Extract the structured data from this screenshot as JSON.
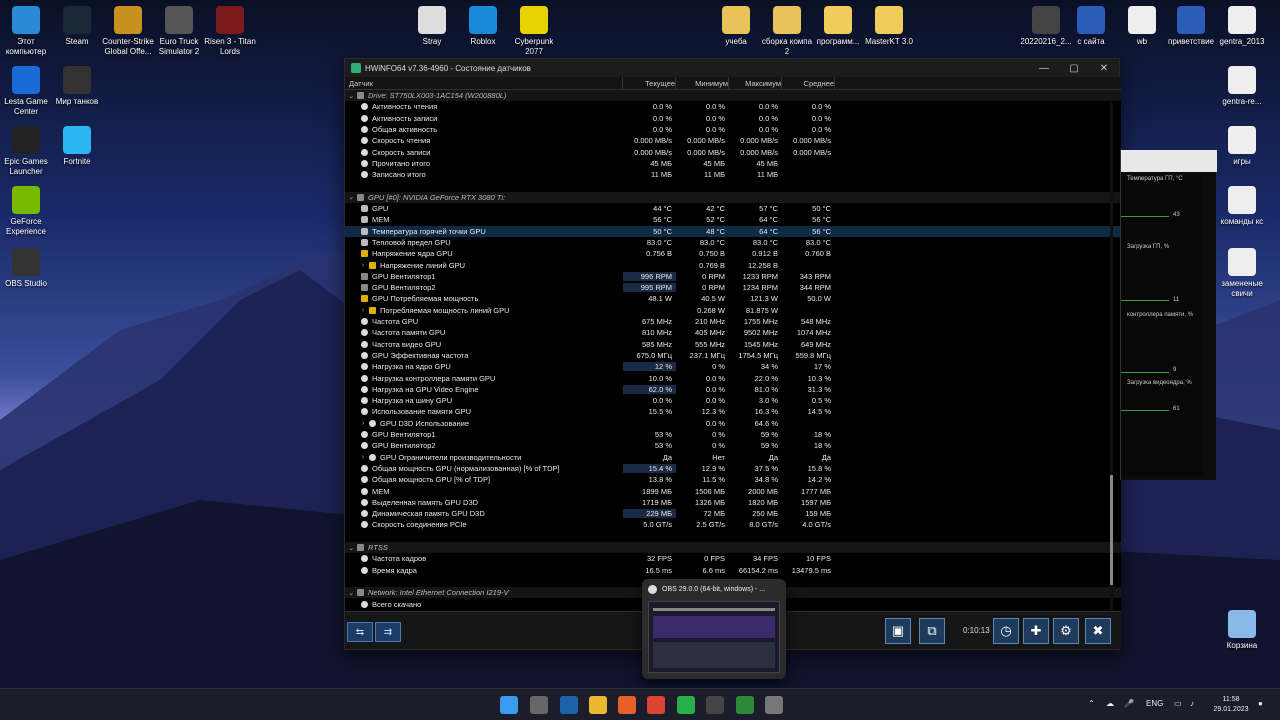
{
  "desktop_icons": [
    {
      "label": "Этот компьютер",
      "icon": "monitor-icon",
      "color": "#2a8ad8"
    },
    {
      "label": "Steam",
      "icon": "steam-icon",
      "color": "#1b2838"
    },
    {
      "label": "Counter-Strike Global Offe...",
      "icon": "csgo-icon",
      "color": "#c8901e"
    },
    {
      "label": "Euro Truck Simulator 2",
      "icon": "truck-icon",
      "color": "#555"
    },
    {
      "label": "Risen 3 - Titan Lords",
      "icon": "risen-icon",
      "color": "#7a1a1a"
    },
    {
      "label": "Stray",
      "icon": "cat-icon",
      "color": "#ddd"
    },
    {
      "label": "Roblox",
      "icon": "roblox-icon",
      "color": "#1a8ad8"
    },
    {
      "label": "Cyberpunk 2077",
      "icon": "cyberpunk-icon",
      "color": "#e6d200"
    },
    {
      "label": "учеба",
      "icon": "folder-icon",
      "color": "#e8c25a"
    },
    {
      "label": "сборка компа 2",
      "icon": "folder-icon",
      "color": "#e8c25a"
    },
    {
      "label": "программ...",
      "icon": "folder-icon",
      "color": "#f0cc5a"
    },
    {
      "label": "MasterKT 3.0",
      "icon": "folder-icon",
      "color": "#f0cc5a"
    },
    {
      "label": "20220216_2...",
      "icon": "image-icon",
      "color": "#444"
    },
    {
      "label": "с сайта",
      "icon": "word-icon",
      "color": "#2b5db8"
    },
    {
      "label": "wb",
      "icon": "file-icon",
      "color": "#eee"
    },
    {
      "label": "приветствие",
      "icon": "word-icon",
      "color": "#2b5db8"
    },
    {
      "label": "gentra_2013",
      "icon": "spreadsheet-icon",
      "color": "#eee"
    },
    {
      "label": "Lesta Game Center",
      "icon": "lesta-icon",
      "color": "#1a6ad8"
    },
    {
      "label": "Мир танков",
      "icon": "tank-icon",
      "color": "#333"
    },
    {
      "label": "Epic Games Launcher",
      "icon": "epic-icon",
      "color": "#222"
    },
    {
      "label": "Fortnite",
      "icon": "fortnite-icon",
      "color": "#2ab6f0"
    },
    {
      "label": "GeForce Experience",
      "icon": "nvidia-icon",
      "color": "#76b900"
    },
    {
      "label": "OBS Studio",
      "icon": "obs-icon",
      "color": "#333"
    },
    {
      "label": "gentra-re...",
      "icon": "pdf-icon",
      "color": "#eee"
    },
    {
      "label": "игры",
      "icon": "file-icon",
      "color": "#eee"
    },
    {
      "label": "команды кс",
      "icon": "file-icon",
      "color": "#eee"
    },
    {
      "label": "замененые свичи",
      "icon": "file-icon",
      "color": "#eee"
    },
    {
      "label": "Корзина",
      "icon": "recycle-bin-icon",
      "color": "#8ab8e8"
    }
  ],
  "window": {
    "title": "HWiNFO64 v7.36-4960 - Состояние датчиков",
    "minimize": "—",
    "maximize": "▢",
    "close": "✕"
  },
  "table": {
    "headers": [
      "Датчик",
      "Текущее",
      "Минимум",
      "Максимум",
      "Среднее"
    ],
    "rows": [
      {
        "type": "group",
        "name": "Drive: ST750LX003-1AC154 (W200880L)"
      },
      {
        "type": "row",
        "icon": "dot",
        "name": "Активность чтения",
        "v": [
          "0.0 %",
          "0.0 %",
          "0.0 %",
          "0.0 %"
        ]
      },
      {
        "type": "row",
        "icon": "dot",
        "name": "Активность записи",
        "v": [
          "0.0 %",
          "0.0 %",
          "0.0 %",
          "0.0 %"
        ]
      },
      {
        "type": "row",
        "icon": "dot",
        "name": "Общая активность",
        "v": [
          "0.0 %",
          "0.0 %",
          "0.0 %",
          "0.0 %"
        ]
      },
      {
        "type": "row",
        "icon": "dot",
        "name": "Скорость чтения",
        "v": [
          "0.000 MB/s",
          "0.000 MB/s",
          "0.000 MB/s",
          "0.000 MB/s"
        ]
      },
      {
        "type": "row",
        "icon": "dot",
        "name": "Скорость записи",
        "v": [
          "0.000 MB/s",
          "0.000 MB/s",
          "0.000 MB/s",
          "0.000 MB/s"
        ]
      },
      {
        "type": "row",
        "icon": "dot",
        "name": "Прочитано итого",
        "v": [
          "45 МБ",
          "45 МБ",
          "45 МБ",
          ""
        ]
      },
      {
        "type": "row",
        "icon": "dot",
        "name": "Записано итого",
        "v": [
          "11 МБ",
          "11 МБ",
          "11 МБ",
          ""
        ]
      },
      {
        "type": "spacer"
      },
      {
        "type": "group",
        "name": "GPU [#0]: NVIDIA GeForce RTX 3080 Ti:"
      },
      {
        "type": "row",
        "icon": "therm",
        "name": "GPU",
        "v": [
          "44 °C",
          "42 °C",
          "57 °C",
          "50 °C"
        ]
      },
      {
        "type": "row",
        "icon": "therm",
        "name": "MEM",
        "v": [
          "56 °C",
          "52 °C",
          "64 °C",
          "56 °C"
        ]
      },
      {
        "type": "row",
        "icon": "therm",
        "name": "Температура горячей точки GPU",
        "v": [
          "50 °C",
          "48 °C",
          "64 °C",
          "56 °C"
        ],
        "selected": true
      },
      {
        "type": "row",
        "icon": "therm",
        "name": "Тепловой предел GPU",
        "v": [
          "83.0 °C",
          "83.0 °C",
          "83.0 °C",
          "83.0 °C"
        ]
      },
      {
        "type": "row",
        "icon": "bolt",
        "name": "Напряжение ядра GPU",
        "v": [
          "0.756 В",
          "0.750 В",
          "0.912 В",
          "0.760 В"
        ]
      },
      {
        "type": "sub",
        "icon": "bolt",
        "name": "Напряжение линий GPU",
        "v": [
          "",
          "0.769 В",
          "12.258 В",
          ""
        ]
      },
      {
        "type": "row",
        "icon": "fan",
        "name": "GPU Вентилятор1",
        "v": [
          "996 RPM",
          "0 RPM",
          "1233 RPM",
          "343 RPM"
        ],
        "hl": true
      },
      {
        "type": "row",
        "icon": "fan",
        "name": "GPU Вентилятор2",
        "v": [
          "995 RPM",
          "0 RPM",
          "1234 RPM",
          "344 RPM"
        ],
        "hl": true
      },
      {
        "type": "row",
        "icon": "bolt",
        "name": "GPU Потребляемая мощность",
        "v": [
          "48.1 W",
          "40.5 W",
          "121.3 W",
          "50.0 W"
        ]
      },
      {
        "type": "sub",
        "icon": "bolt",
        "name": "Потребляемая мощность линий GPU",
        "v": [
          "",
          "0.268 W",
          "81.875 W",
          ""
        ]
      },
      {
        "type": "row",
        "icon": "dot",
        "name": "Частота GPU",
        "v": [
          "675 MHz",
          "210 MHz",
          "1755 MHz",
          "548 MHz"
        ]
      },
      {
        "type": "row",
        "icon": "dot",
        "name": "Частота памяти GPU",
        "v": [
          "810 MHz",
          "405 MHz",
          "9502 MHz",
          "1074 MHz"
        ]
      },
      {
        "type": "row",
        "icon": "dot",
        "name": "Частота видео GPU",
        "v": [
          "585 MHz",
          "555 MHz",
          "1545 MHz",
          "649 MHz"
        ]
      },
      {
        "type": "row",
        "icon": "dot",
        "name": "GPU Эффективная частота",
        "v": [
          "675.0 МГц",
          "237.1 МГц",
          "1754.5 МГц",
          "559.8 МГц"
        ]
      },
      {
        "type": "row",
        "icon": "dot",
        "name": "Нагрузка на ядро GPU",
        "v": [
          "12 %",
          "0 %",
          "34 %",
          "17 %"
        ],
        "hl": true
      },
      {
        "type": "row",
        "icon": "dot",
        "name": "Нагрузка контроллера памяти GPU",
        "v": [
          "10.0 %",
          "0.0 %",
          "22.0 %",
          "10.3 %"
        ]
      },
      {
        "type": "row",
        "icon": "dot",
        "name": "Нагрузка на GPU Video Engine",
        "v": [
          "62.0 %",
          "0.0 %",
          "81.0 %",
          "31.3 %"
        ],
        "hl": true
      },
      {
        "type": "row",
        "icon": "dot",
        "name": "Нагрузка на шину GPU",
        "v": [
          "0.0 %",
          "0.0 %",
          "3.0 %",
          "0.5 %"
        ]
      },
      {
        "type": "row",
        "icon": "dot",
        "name": "Использование памяти GPU",
        "v": [
          "15.5 %",
          "12.3 %",
          "16.3 %",
          "14.5 %"
        ]
      },
      {
        "type": "sub",
        "icon": "dot",
        "name": "GPU D3D Использование",
        "v": [
          "",
          "0.0 %",
          "64.6 %",
          ""
        ]
      },
      {
        "type": "row",
        "icon": "dot",
        "name": "GPU Вентилятор1",
        "v": [
          "53 %",
          "0 %",
          "59 %",
          "18 %"
        ]
      },
      {
        "type": "row",
        "icon": "dot",
        "name": "GPU Вентилятор2",
        "v": [
          "53 %",
          "0 %",
          "59 %",
          "18 %"
        ]
      },
      {
        "type": "sub",
        "icon": "dot",
        "name": "GPU Ограничители производительности",
        "v": [
          "Да",
          "Нет",
          "Да",
          "Да"
        ]
      },
      {
        "type": "row",
        "icon": "dot",
        "name": "Общая мощность GPU (нормализованная) [% of TDP]",
        "v": [
          "15.4 %",
          "12.9 %",
          "37.5 %",
          "15.8 %"
        ],
        "hl": true
      },
      {
        "type": "row",
        "icon": "dot",
        "name": "Общая мощность GPU [% of TDP]",
        "v": [
          "13.8 %",
          "11.5 %",
          "34.8 %",
          "14.2 %"
        ]
      },
      {
        "type": "row",
        "icon": "dot",
        "name": "MEM",
        "v": [
          "1899 МБ",
          "1506 МБ",
          "2000 МБ",
          "1777 МБ"
        ]
      },
      {
        "type": "row",
        "icon": "dot",
        "name": "Выделенная память GPU D3D",
        "v": [
          "1719 МБ",
          "1326 МБ",
          "1820 МБ",
          "1597 МБ"
        ]
      },
      {
        "type": "row",
        "icon": "dot",
        "name": "Динамическая память GPU D3D",
        "v": [
          "229 МБ",
          "72 МБ",
          "250 МБ",
          "159 МБ"
        ],
        "hl": true
      },
      {
        "type": "row",
        "icon": "dot",
        "name": "Скорость соединения PCIe",
        "v": [
          "5.0 GT/s",
          "2.5 GT/s",
          "8.0 GT/s",
          "4.0 GT/s"
        ]
      },
      {
        "type": "spacer"
      },
      {
        "type": "group",
        "name": "RTSS"
      },
      {
        "type": "row",
        "icon": "dot",
        "name": "Частота кадров",
        "v": [
          "32 FPS",
          "0 FPS",
          "34 FPS",
          "10 FPS"
        ]
      },
      {
        "type": "row",
        "icon": "dot",
        "name": "Время кадра",
        "v": [
          "16.5 ms",
          "6.6 ms",
          "66154.2 ms",
          "13479.5 ms"
        ]
      },
      {
        "type": "spacer"
      },
      {
        "type": "group",
        "name": "Network: Intel Ethernet Connection I219-V"
      },
      {
        "type": "row",
        "icon": "dot",
        "name": "Всего скачано",
        "v": [
          "",
          "",
          "",
          ""
        ]
      }
    ]
  },
  "footer": {
    "timer": "0:10:13"
  },
  "graph_panel": {
    "labels": [
      "Температура ГП, °C",
      "Загрузка ГП, %",
      "контроллера памяти, %",
      "Загрузка видеоядра, %"
    ],
    "numbers": [
      "43",
      "11",
      "9",
      "61"
    ]
  },
  "obs_popup": {
    "title": "OBS 29.0.0 (64-bit, windows) - ..."
  },
  "taskbar": {
    "lang": "ENG",
    "time": "11:58",
    "date": "29.01.2023",
    "apps": [
      {
        "icon": "windows-start-icon",
        "color": "#3a9af0"
      },
      {
        "icon": "calculator-icon",
        "color": "#666"
      },
      {
        "icon": "steam-icon",
        "color": "#1b62a8"
      },
      {
        "icon": "file-explorer-icon",
        "color": "#e8b830"
      },
      {
        "icon": "firefox-icon",
        "color": "#e8602a"
      },
      {
        "icon": "chrome-icon",
        "color": "#dd4433"
      },
      {
        "icon": "whatsapp-icon",
        "color": "#27b04a"
      },
      {
        "icon": "obs-icon",
        "color": "#444"
      },
      {
        "icon": "xbox-icon",
        "color": "#2a8a3a"
      },
      {
        "icon": "hwinfo-icon",
        "color": "#777"
      }
    ]
  }
}
